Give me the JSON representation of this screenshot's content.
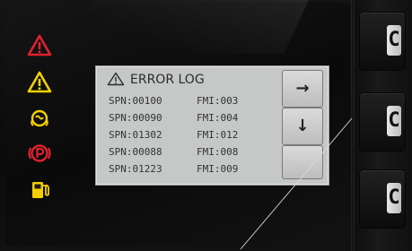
{
  "colors": {
    "warning_red": "#e0222d",
    "warning_yellow": "#f4d000",
    "screen_bg": "#c6c8c8",
    "bezel": "#0b0b0b"
  },
  "warning_indicators": [
    {
      "icon": "red-warning-triangle-icon",
      "color": "#e0222d"
    },
    {
      "icon": "yellow-warning-triangle-icon",
      "color": "#f4d000"
    },
    {
      "icon": "glow-plug-icon",
      "color": "#f4d000"
    },
    {
      "icon": "parking-brake-icon",
      "color": "#e0222d"
    },
    {
      "icon": "fuel-icon",
      "color": "#f4d000"
    }
  ],
  "error_log": {
    "title": "ERROR LOG",
    "title_icon": "warning-triangle-outline-icon",
    "rows": [
      {
        "spn": "SPN:00100",
        "fmi": "FMI:003"
      },
      {
        "spn": "SPN:00090",
        "fmi": "FMI:004"
      },
      {
        "spn": "SPN:01302",
        "fmi": "FMI:012"
      },
      {
        "spn": "SPN:00088",
        "fmi": "FMI:008"
      },
      {
        "spn": "SPN:01223",
        "fmi": "FMI:009"
      }
    ],
    "nav": {
      "next_icon": "right-arrow-icon",
      "next_glyph": "→",
      "down_icon": "down-arrow-icon",
      "down_glyph": "↓"
    }
  },
  "softkeys": [
    {
      "glyph": "C"
    },
    {
      "glyph": "C"
    },
    {
      "glyph": "C"
    }
  ]
}
